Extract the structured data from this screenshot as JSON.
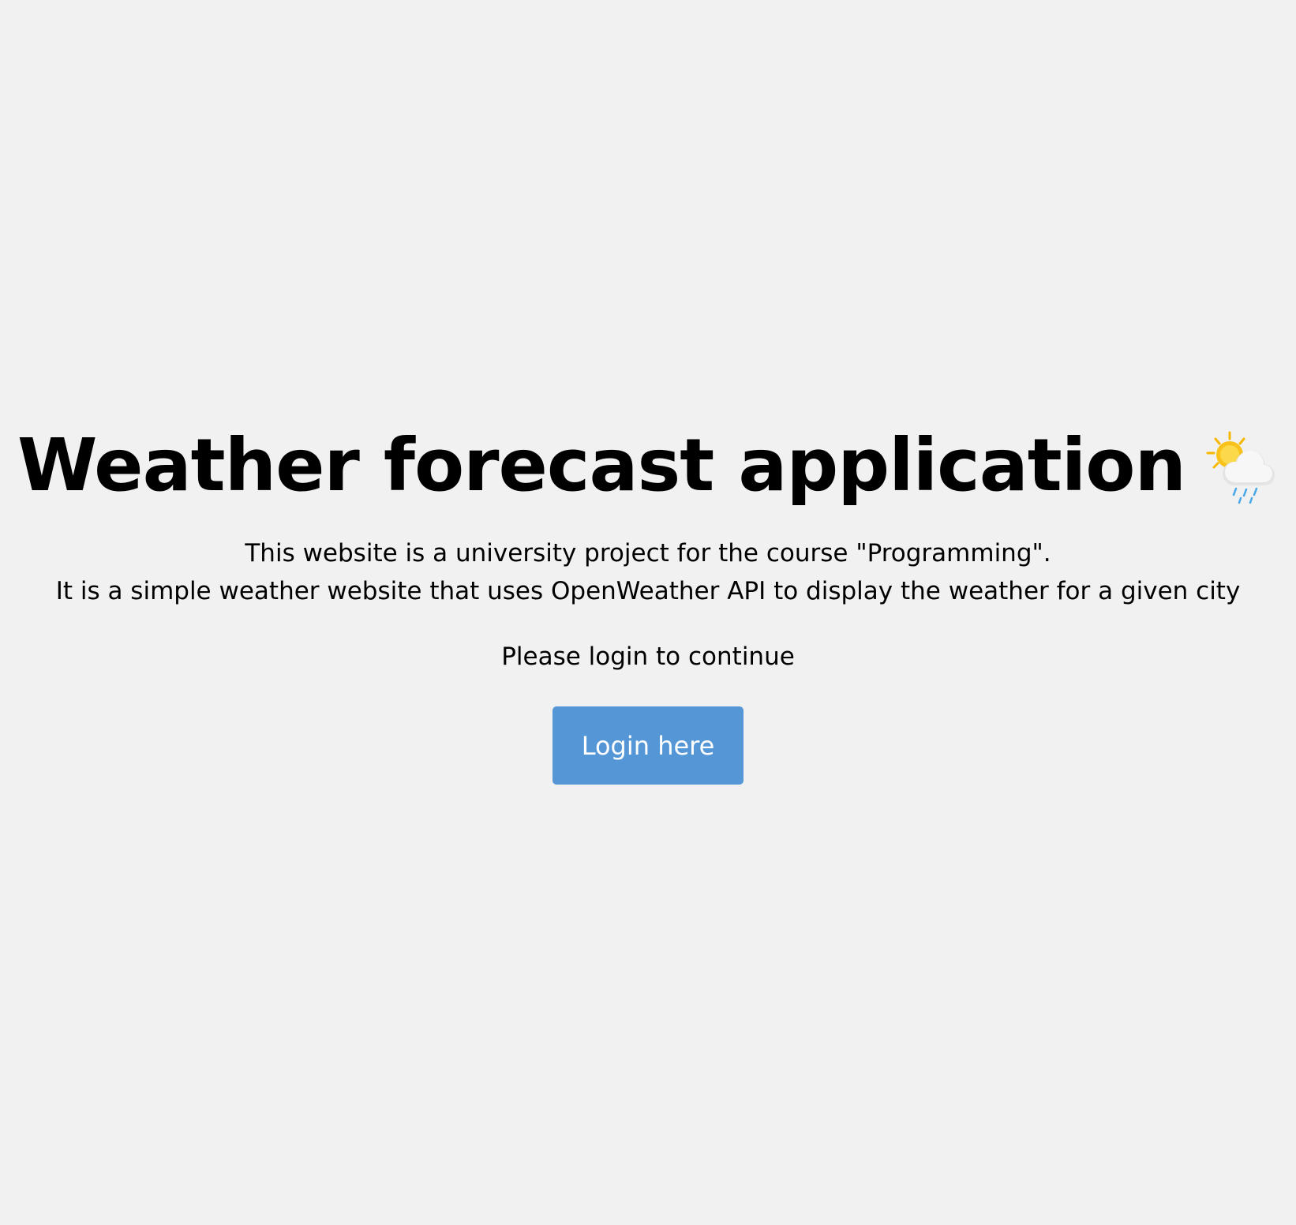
{
  "hero": {
    "title": "Weather forecast application",
    "title_icon": "sun-behind-rain-cloud-icon",
    "description_lines": [
      "This website is a university project for the course \"Programming\".",
      "It is a simple weather website that uses OpenWeather API to display the weather for a given city"
    ],
    "prompt": "Please login to continue",
    "login_label": "Login here"
  },
  "colors": {
    "background": "#f1f1f1",
    "button": "#5597d6",
    "button_text": "#ffffff",
    "text": "#000000"
  }
}
